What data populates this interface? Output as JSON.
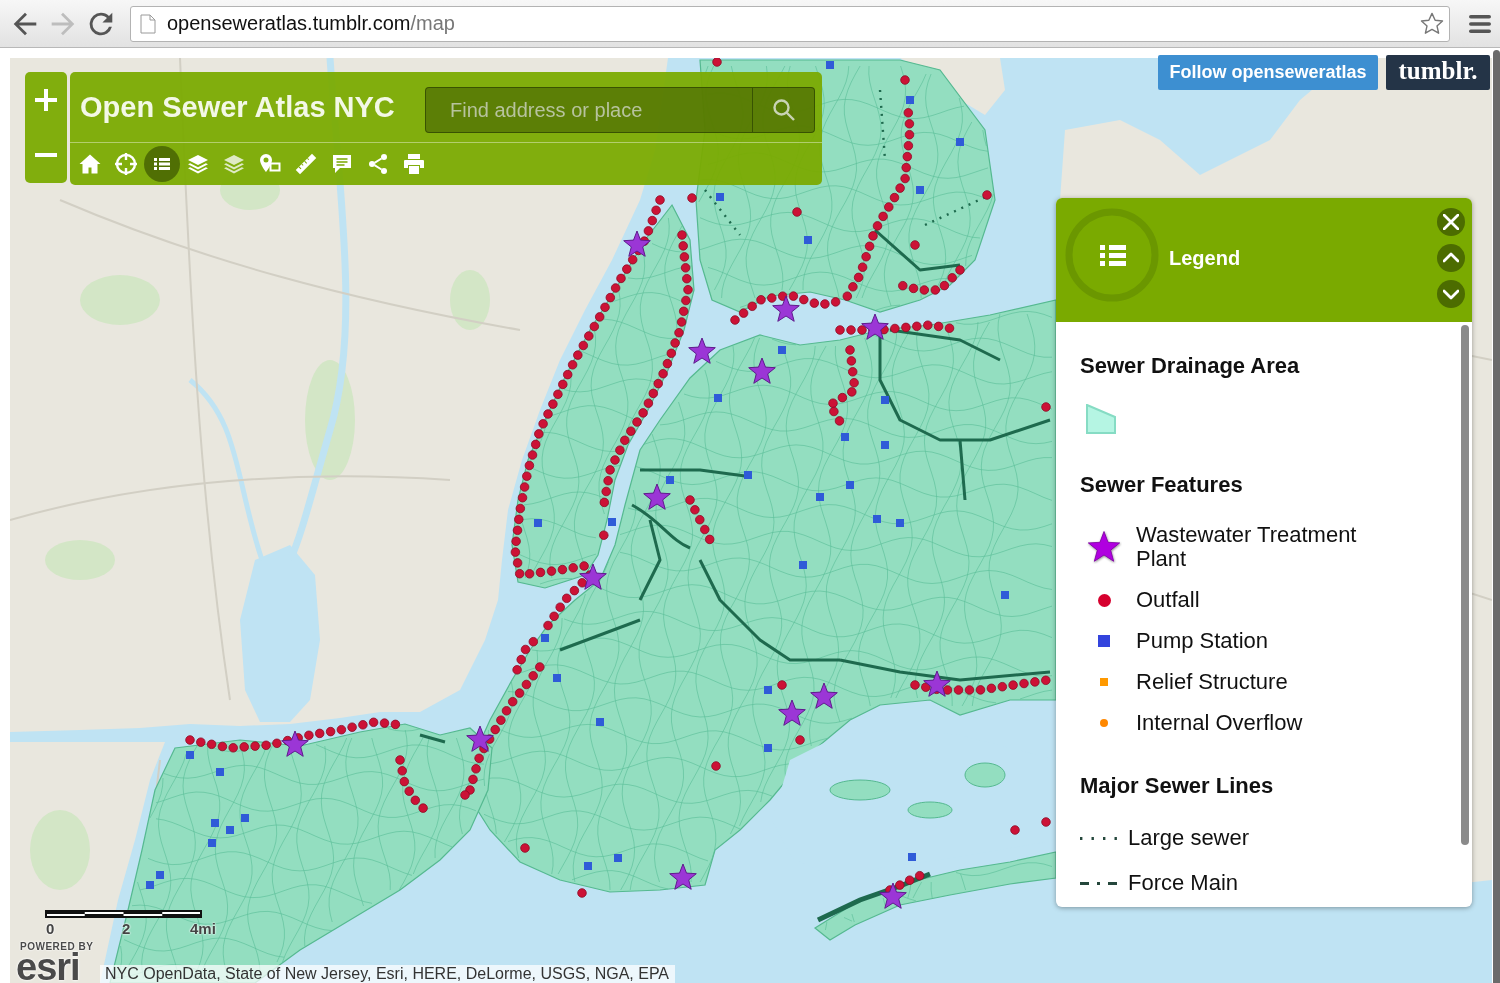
{
  "browser": {
    "nav": [
      {
        "kind": "back",
        "disabled": false
      },
      {
        "kind": "forward",
        "disabled": true
      },
      {
        "kind": "reload",
        "disabled": false
      }
    ],
    "url_host": "openseweratlas.tumblr.com",
    "url_path": "/map"
  },
  "app": {
    "title": "Open Sewer Atlas NYC",
    "search": {
      "placeholder": "Find address or place"
    },
    "tools": [
      {
        "kind": "home",
        "selected": false
      },
      {
        "kind": "locate",
        "selected": false
      },
      {
        "kind": "legend",
        "selected": true
      },
      {
        "kind": "basemap",
        "selected": false
      },
      {
        "kind": "layers",
        "selected": false
      },
      {
        "kind": "location",
        "selected": false
      },
      {
        "kind": "measure",
        "selected": false
      },
      {
        "kind": "comment",
        "selected": false
      },
      {
        "kind": "share",
        "selected": false
      },
      {
        "kind": "print",
        "selected": false
      }
    ]
  },
  "follow_button": "Follow openseweratlas",
  "tumblr_button": "tumblr.",
  "legend": {
    "title": "Legend",
    "sections": [
      {
        "title": "Sewer Drainage Area",
        "items": [
          {
            "kind": "area",
            "color": "#b5f5e3"
          }
        ]
      },
      {
        "title": "Sewer Features",
        "items": [
          {
            "kind": "star",
            "label": "Wastewater Treatment Plant",
            "color": "#b000e0"
          },
          {
            "kind": "dot",
            "label": "Outfall",
            "color": "#d6002e"
          },
          {
            "kind": "square",
            "label": "Pump Station",
            "color": "#3344dd"
          },
          {
            "kind": "small-square",
            "label": "Relief Structure",
            "color": "#ff9900"
          },
          {
            "kind": "small-dot",
            "label": "Internal Overflow",
            "color": "#ff8800"
          }
        ]
      },
      {
        "title": "Major Sewer Lines",
        "items": [
          {
            "kind": "dotted-line",
            "label": "Large sewer"
          },
          {
            "kind": "dash-dot-line",
            "label": "Force Main"
          }
        ]
      }
    ]
  },
  "map": {
    "scale_labels": [
      "0",
      "2",
      "4mi"
    ],
    "powered_by": "POWERED BY",
    "esri_logo": "esri",
    "attribution": "NYC OpenData, State of New Jersey, Esri, HERE, DeLorme, USGS, NGA, EPA"
  }
}
